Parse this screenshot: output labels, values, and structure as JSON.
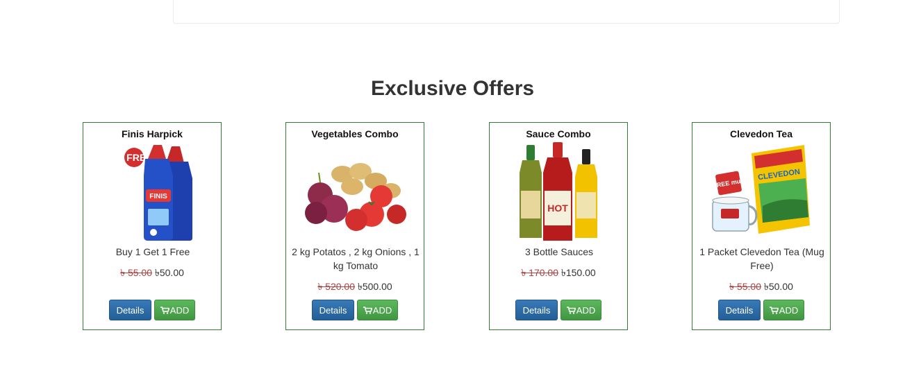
{
  "section": {
    "title": "Exclusive Offers"
  },
  "products": [
    {
      "title": "Finis Harpick",
      "description": "Buy 1 Get 1 Free",
      "old_price": "৳ 55.00",
      "new_price": "৳50.00",
      "details_label": "Details",
      "add_label": "ADD",
      "image_label": "FINIS",
      "badge_text": "1 FREE"
    },
    {
      "title": "Vegetables Combo",
      "description": "2 kg Potatos , 2 kg Onions , 1 kg Tomato",
      "old_price": "৳ 520.00",
      "new_price": "৳500.00",
      "details_label": "Details",
      "add_label": "ADD"
    },
    {
      "title": "Sauce Combo",
      "description": "3 Bottle Sauces",
      "old_price": "৳ 170.00",
      "new_price": "৳150.00",
      "details_label": "Details",
      "add_label": "ADD",
      "image_label": "HOT"
    },
    {
      "title": "Clevedon Tea",
      "description": "1 Packet Clevedon Tea (Mug Free)",
      "old_price": "৳ 55.00",
      "new_price": "৳50.00",
      "details_label": "Details",
      "add_label": "ADD",
      "image_label": "CLEVEDON",
      "badge_text": "FREE mug"
    }
  ],
  "colors": {
    "card_border": "#2e7d32",
    "details_button": "#2a6aa6",
    "add_button": "#4cae4c",
    "old_price": "#a94442"
  },
  "icons": {
    "cart": "cart-icon"
  }
}
